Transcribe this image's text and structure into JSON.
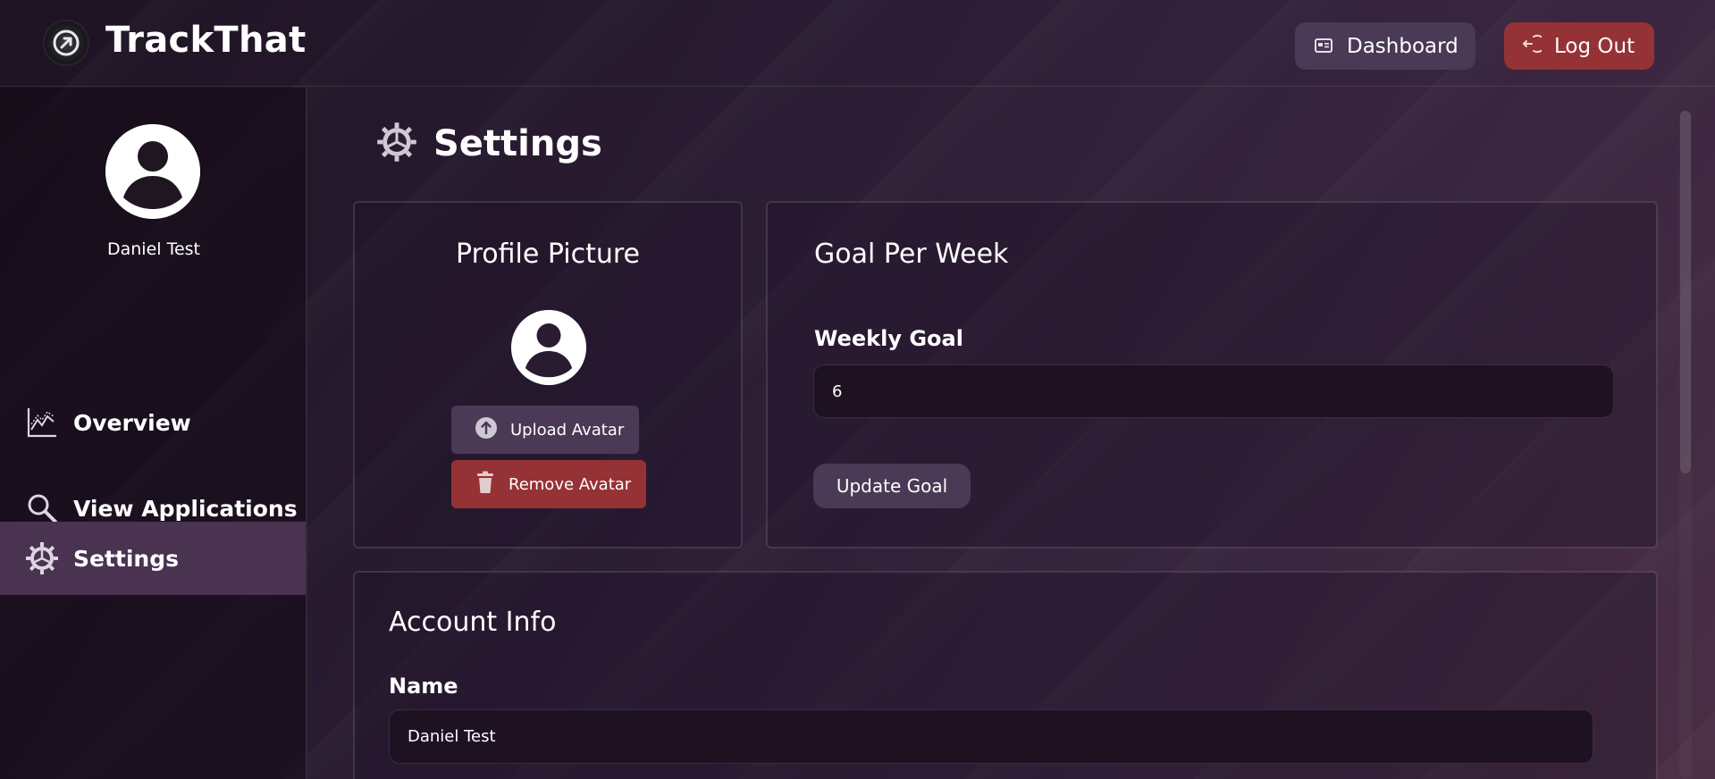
{
  "app": {
    "title": "TrackThat"
  },
  "header": {
    "dashboard_label": "Dashboard",
    "logout_label": "Log Out"
  },
  "sidebar": {
    "user_name": "Daniel Test",
    "items": [
      {
        "label": "Overview",
        "icon": "chart-line-icon",
        "active": false
      },
      {
        "label": "View Applications",
        "icon": "search-icon",
        "active": false
      },
      {
        "label": "Settings",
        "icon": "gear-icon",
        "active": true
      }
    ]
  },
  "main": {
    "page_title": "Settings",
    "profile": {
      "title": "Profile Picture",
      "upload_label": "Upload Avatar",
      "remove_label": "Remove Avatar"
    },
    "goal": {
      "title": "Goal Per Week",
      "field_label": "Weekly Goal",
      "value": "6",
      "button_label": "Update Goal"
    },
    "account": {
      "title": "Account Info",
      "name_label": "Name",
      "name_value": "Daniel Test"
    }
  },
  "colors": {
    "accent_purple": "#4a3a55",
    "danger_red": "#953235",
    "active_nav": "#4a3350"
  }
}
